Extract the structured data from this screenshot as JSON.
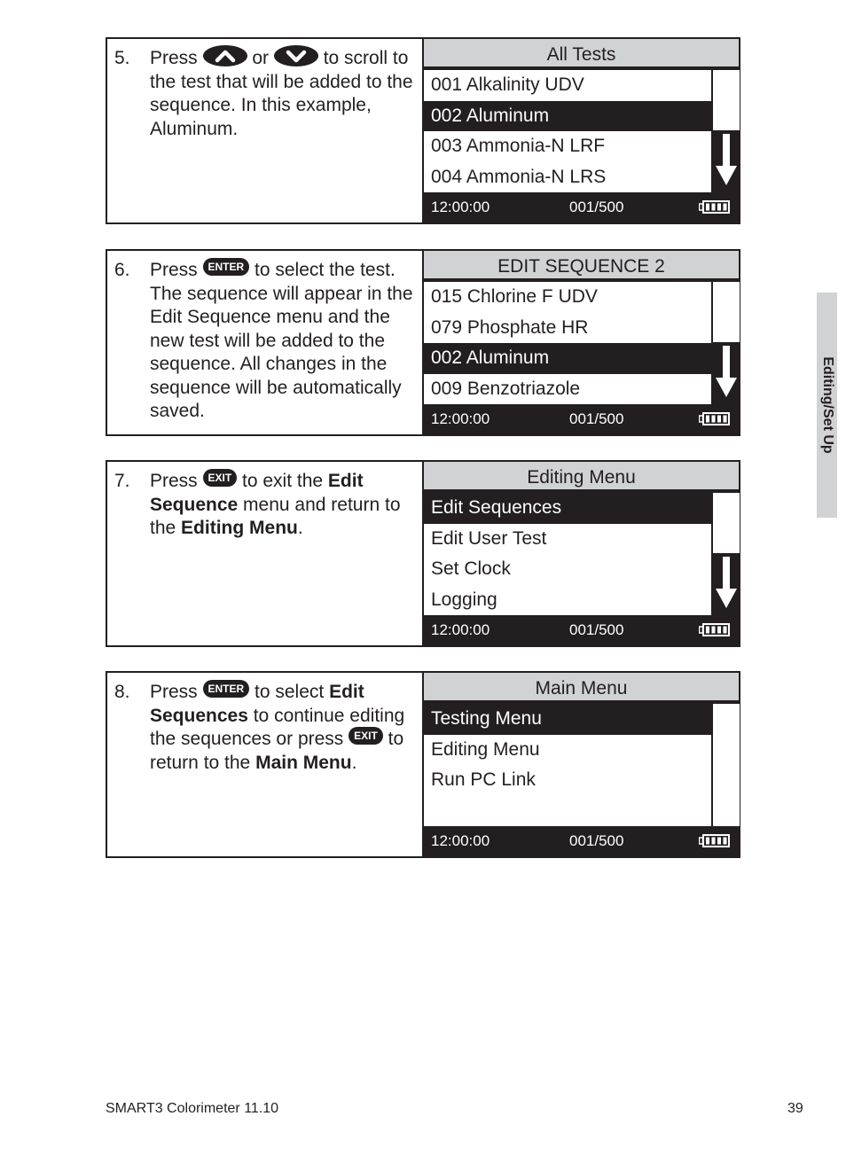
{
  "side_tab": "Editing/Set Up",
  "footer": {
    "doc_title": "SMART3 Colorimeter 11.10",
    "page_number": "39"
  },
  "keys": {
    "up": "up-arrow",
    "down": "down-arrow",
    "enter": "ENTER",
    "exit": "EXIT"
  },
  "steps": [
    {
      "number": "5.",
      "text": [
        {
          "t": "Press "
        },
        {
          "key": "up"
        },
        {
          "t": " or "
        },
        {
          "key": "down"
        },
        {
          "t": " to scroll to the test that will be added to the sequence. In this example, Aluminum."
        }
      ],
      "screen": {
        "title": "All Tests",
        "rows": [
          "001 Alkalinity UDV",
          "002 Aluminum",
          "003 Ammonia-N LRF",
          "004 Ammonia-N LRS"
        ],
        "selected_index": 1,
        "scroll_arrow": true,
        "time": "12:00:00",
        "count": "001/500",
        "battery_bars": 4
      }
    },
    {
      "number": "6.",
      "text": [
        {
          "t": "Press "
        },
        {
          "key": "enter"
        },
        {
          "t": " to select the test. The sequence will appear in the Edit Sequence menu and the new test will be added to the sequence. All changes in the sequence will be automatically saved."
        }
      ],
      "screen": {
        "title": "EDIT SEQUENCE 2",
        "rows": [
          "015 Chlorine F UDV",
          "079 Phosphate HR",
          "002 Aluminum",
          "009 Benzotriazole"
        ],
        "selected_index": 2,
        "scroll_arrow": true,
        "time": "12:00:00",
        "count": "001/500",
        "battery_bars": 4
      }
    },
    {
      "number": "7.",
      "text": [
        {
          "t": "Press "
        },
        {
          "key": "exit"
        },
        {
          "t": " to exit the "
        },
        {
          "b": "Edit Sequence"
        },
        {
          "t": " menu and return to the "
        },
        {
          "b": "Editing Menu"
        },
        {
          "t": "."
        }
      ],
      "screen": {
        "title": "Editing Menu",
        "rows": [
          "Edit Sequences",
          "Edit User Test",
          "Set Clock",
          "Logging"
        ],
        "selected_index": 0,
        "scroll_arrow": true,
        "time": "12:00:00",
        "count": "001/500",
        "battery_bars": 4
      }
    },
    {
      "number": "8.",
      "text": [
        {
          "t": "Press "
        },
        {
          "key": "enter"
        },
        {
          "t": " to select "
        },
        {
          "b": "Edit Sequences"
        },
        {
          "t": " to continue editing the sequences or press "
        },
        {
          "key": "exit"
        },
        {
          "t": " to return to the "
        },
        {
          "b": "Main Menu"
        },
        {
          "t": "."
        }
      ],
      "screen": {
        "title": "Main Menu",
        "rows": [
          "Testing Menu",
          "Editing Menu",
          "Run PC Link",
          ""
        ],
        "selected_index": 0,
        "scroll_arrow": false,
        "time": "12:00:00",
        "count": "001/500",
        "battery_bars": 4
      }
    }
  ]
}
